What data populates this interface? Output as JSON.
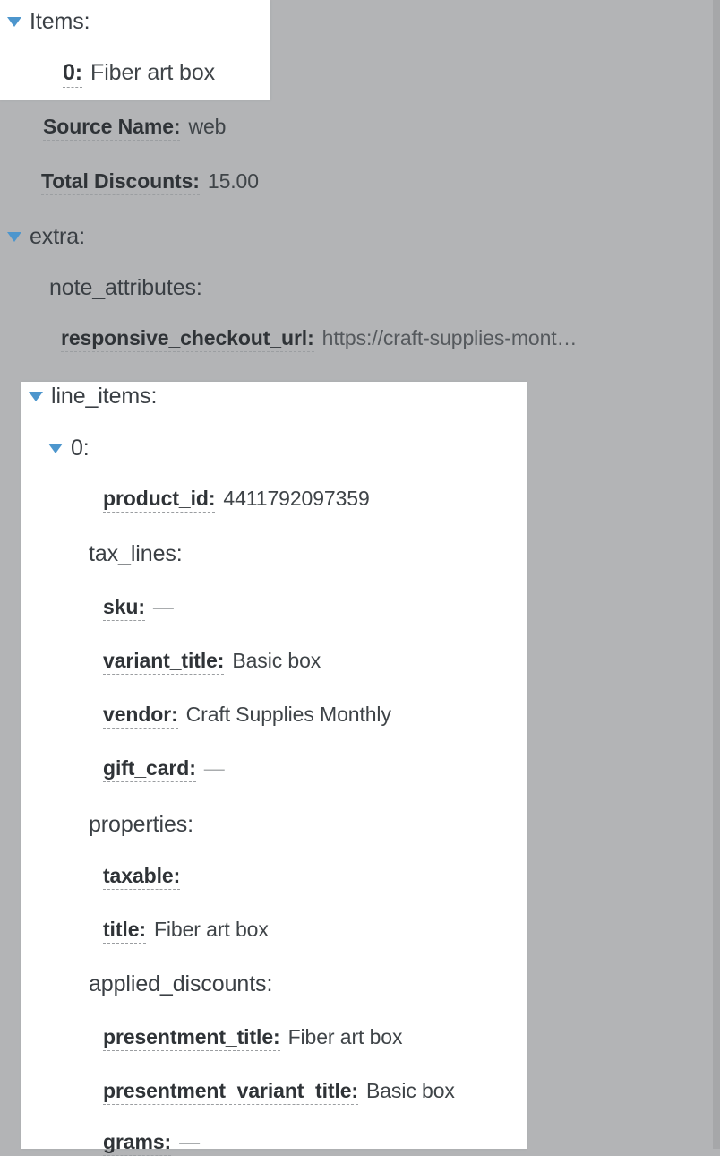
{
  "tree": {
    "items_section": {
      "caret_icon": "caret-down-icon",
      "label": "Items:",
      "entries": [
        {
          "key": "0:",
          "value": "Fiber art box"
        }
      ]
    },
    "order_fields": [
      {
        "key": "Source Name:",
        "value": "web"
      },
      {
        "key": "Total Discounts:",
        "value": "15.00"
      }
    ],
    "extra_section": {
      "caret_icon": "caret-down-icon",
      "label": "extra:",
      "note_attributes_label": "note_attributes:",
      "note_attributes": [
        {
          "key": "responsive_checkout_url:",
          "value": "https://craft-supplies-mont…"
        }
      ]
    },
    "line_items_section": {
      "caret_icon": "caret-down-icon",
      "label": "line_items:",
      "index_caret_icon": "caret-down-icon",
      "index_label": "0:",
      "fields": [
        {
          "key": "product_id:",
          "value": "4411792097359",
          "type": "pair"
        },
        {
          "key": "tax_lines:",
          "value": "",
          "type": "group"
        },
        {
          "key": "sku:",
          "value": "—",
          "type": "pair",
          "empty": true
        },
        {
          "key": "variant_title:",
          "value": "Basic box",
          "type": "pair"
        },
        {
          "key": "vendor:",
          "value": "Craft Supplies Monthly",
          "type": "pair"
        },
        {
          "key": "gift_card:",
          "value": "—",
          "type": "pair",
          "empty": true
        },
        {
          "key": "properties:",
          "value": "",
          "type": "group"
        },
        {
          "key": "taxable:",
          "value": "",
          "type": "pair"
        },
        {
          "key": "title:",
          "value": "Fiber art box",
          "type": "pair"
        },
        {
          "key": "applied_discounts:",
          "value": "",
          "type": "group"
        },
        {
          "key": "presentment_title:",
          "value": "Fiber art box",
          "type": "pair"
        },
        {
          "key": "presentment_variant_title:",
          "value": "Basic box",
          "type": "pair"
        },
        {
          "key": "grams:",
          "value": "—",
          "type": "pair",
          "empty": true
        }
      ]
    }
  },
  "colors": {
    "background": "#b3b4b6",
    "panel": "#ffffff",
    "caret": "#4d96cd",
    "key_text": "#2f3337",
    "value_text": "#3f4448",
    "dash_text": "#a9acae"
  }
}
